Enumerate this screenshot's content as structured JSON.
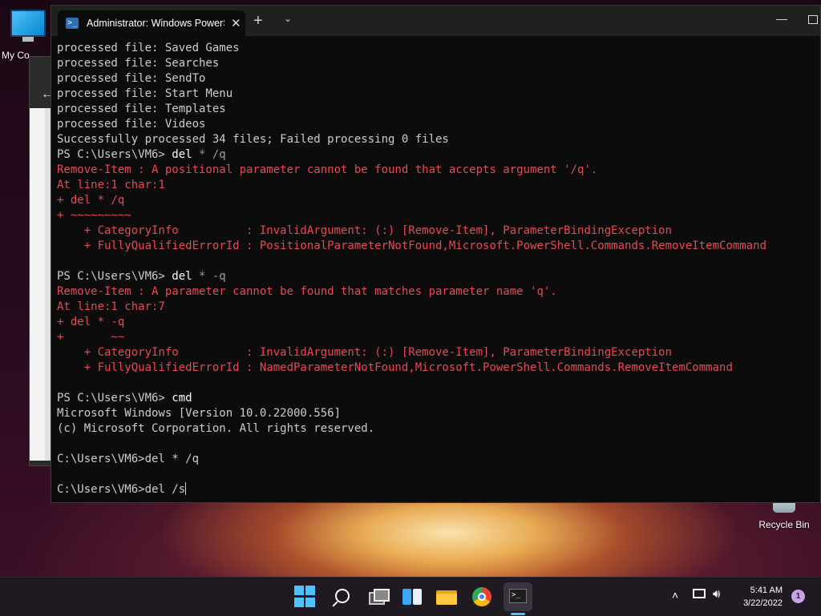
{
  "desktop": {
    "icons": [
      {
        "label": "My Co"
      },
      {
        "label": "Recycle Bin"
      }
    ]
  },
  "window": {
    "tab_title": "Administrator: Windows PowerS",
    "tab_icon_glyph": ">_",
    "close_glyph": "✕",
    "newtab_glyph": "+",
    "dropdown_glyph": "⌄",
    "minimize_glyph": "—"
  },
  "console": {
    "lines": [
      {
        "text": "processed file: Saved Games",
        "style": "normal"
      },
      {
        "text": "processed file: Searches",
        "style": "normal"
      },
      {
        "text": "processed file: SendTo",
        "style": "normal"
      },
      {
        "text": "processed file: Start Menu",
        "style": "normal"
      },
      {
        "text": "processed file: Templates",
        "style": "normal"
      },
      {
        "text": "processed file: Videos",
        "style": "normal"
      },
      {
        "text": "Successfully processed 34 files; Failed processing 0 files",
        "style": "normal"
      },
      {
        "prompt": "PS C:\\Users\\VM6> ",
        "cmd": "del",
        "rest": " * /q",
        "style": "ps"
      },
      {
        "text": "Remove-Item : A positional parameter cannot be found that accepts argument '/q'.",
        "style": "err"
      },
      {
        "text": "At line:1 char:1",
        "style": "err"
      },
      {
        "text": "+ del * /q",
        "style": "err"
      },
      {
        "text": "+ ~~~~~~~~~",
        "style": "err"
      },
      {
        "text": "    + CategoryInfo          : InvalidArgument: (:) [Remove-Item], ParameterBindingException",
        "style": "err"
      },
      {
        "text": "    + FullyQualifiedErrorId : PositionalParameterNotFound,Microsoft.PowerShell.Commands.RemoveItemCommand",
        "style": "err"
      },
      {
        "text": "",
        "style": "normal"
      },
      {
        "prompt": "PS C:\\Users\\VM6> ",
        "cmd": "del",
        "rest": " * -q",
        "style": "ps"
      },
      {
        "text": "Remove-Item : A parameter cannot be found that matches parameter name 'q'.",
        "style": "err"
      },
      {
        "text": "At line:1 char:7",
        "style": "err"
      },
      {
        "text": "+ del * -q",
        "style": "err"
      },
      {
        "text": "+       ~~",
        "style": "err"
      },
      {
        "text": "    + CategoryInfo          : InvalidArgument: (:) [Remove-Item], ParameterBindingException",
        "style": "err"
      },
      {
        "text": "    + FullyQualifiedErrorId : NamedParameterNotFound,Microsoft.PowerShell.Commands.RemoveItemCommand",
        "style": "err"
      },
      {
        "text": "",
        "style": "normal"
      },
      {
        "prompt": "PS C:\\Users\\VM6> ",
        "cmd": "cmd",
        "rest": "",
        "style": "ps"
      },
      {
        "text": "Microsoft Windows [Version 10.0.22000.556]",
        "style": "normal"
      },
      {
        "text": "(c) Microsoft Corporation. All rights reserved.",
        "style": "normal"
      },
      {
        "text": "",
        "style": "normal"
      },
      {
        "text": "C:\\Users\\VM6>del * /q",
        "style": "normal"
      },
      {
        "text": "",
        "style": "normal"
      },
      {
        "text": "C:\\Users\\VM6>del /s",
        "style": "input"
      }
    ]
  },
  "taskbar": {
    "clock_time": "5:41 AM",
    "clock_date": "3/22/2022",
    "notification_count": "1",
    "apps": [
      "start-icon",
      "search-icon",
      "task-view-icon",
      "widgets-icon",
      "file-explorer-icon",
      "chrome-icon",
      "terminal-icon"
    ]
  }
}
